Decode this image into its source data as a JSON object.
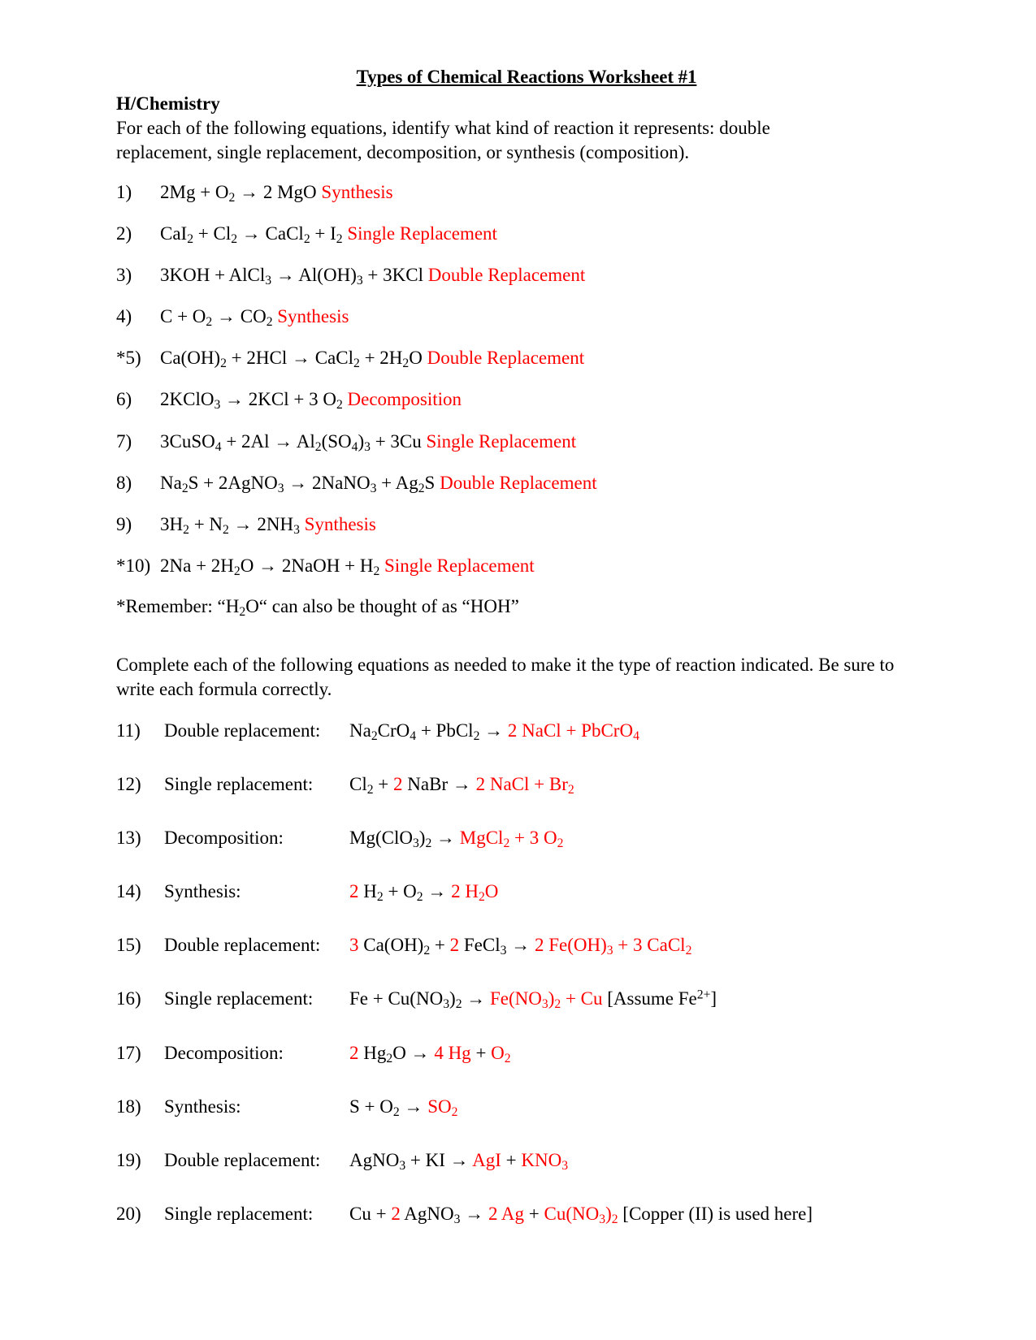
{
  "document": {
    "title": "Types of Chemical Reactions Worksheet #1",
    "course": "H/Chemistry",
    "intro": "For each of the following equations, identify what kind of reaction it represents:  double replacement, single replacement, decomposition, or synthesis (composition).",
    "section2_intro": "Complete each of the following equations as needed to make it the type of reaction indicated.  Be sure to write each formula correctly.",
    "remember_note": "*Remember: “H2O“ can also be thought of as “HOH”"
  },
  "colors": {
    "answer_red": "#ff0000",
    "text_black": "#000000",
    "page_background": "#ffffff"
  },
  "symbols": {
    "arrow": "→"
  },
  "section1": {
    "items": [
      {
        "number": "1)",
        "equation_plain": "2Mg + O2  →  2 MgO",
        "answer_plain": "Synthesis",
        "tokens": [
          {
            "t": "2Mg + O",
            "c": "black"
          },
          {
            "t": "2",
            "c": "black",
            "s": "sub"
          },
          {
            "t": "  →  2 MgO  ",
            "c": "black"
          },
          {
            "t": "Synthesis",
            "c": "red"
          }
        ]
      },
      {
        "number": "2)",
        "equation_plain": "CaI2 + Cl2  →  CaCl2 + I2",
        "answer_plain": "Single Replacement",
        "tokens": [
          {
            "t": "CaI",
            "c": "black"
          },
          {
            "t": "2",
            "c": "black",
            "s": "sub"
          },
          {
            "t": " + Cl",
            "c": "black"
          },
          {
            "t": "2",
            "c": "black",
            "s": "sub"
          },
          {
            "t": "  →  CaCl",
            "c": "black"
          },
          {
            "t": "2",
            "c": "black",
            "s": "sub"
          },
          {
            "t": " + I",
            "c": "black"
          },
          {
            "t": "2",
            "c": "black",
            "s": "sub"
          },
          {
            "t": "   ",
            "c": "black"
          },
          {
            "t": "Single Replacement",
            "c": "red"
          }
        ]
      },
      {
        "number": "3)",
        "equation_plain": "3KOH + AlCl3  →  Al(OH)3 + 3KCl",
        "answer_plain": "Double Replacement",
        "tokens": [
          {
            "t": "3KOH + AlCl",
            "c": "black"
          },
          {
            "t": "3",
            "c": "black",
            "s": "sub"
          },
          {
            "t": "  →  Al(OH)",
            "c": "black"
          },
          {
            "t": "3",
            "c": "black",
            "s": "sub"
          },
          {
            "t": " + 3KCl   ",
            "c": "black"
          },
          {
            "t": "Double Replacement",
            "c": "red"
          }
        ]
      },
      {
        "number": "4)",
        "equation_plain": "C +  O2 → CO2",
        "answer_plain": "Synthesis",
        "tokens": [
          {
            "t": "C +  O",
            "c": "black"
          },
          {
            "t": "2",
            "c": "black",
            "s": "sub"
          },
          {
            "t": " → CO",
            "c": "black"
          },
          {
            "t": "2",
            "c": "black",
            "s": "sub"
          },
          {
            "t": "   ",
            "c": "black"
          },
          {
            "t": "Synthesis",
            "c": "red"
          }
        ]
      },
      {
        "number": "*5)",
        "equation_plain": "Ca(OH)2 + 2HCl  →  CaCl2 + 2H2O",
        "answer_plain": "Double Replacement",
        "tokens": [
          {
            "t": "Ca(OH)",
            "c": "black"
          },
          {
            "t": "2",
            "c": "black",
            "s": "sub"
          },
          {
            "t": " + 2HCl  →  CaCl",
            "c": "black"
          },
          {
            "t": "2",
            "c": "black",
            "s": "sub"
          },
          {
            "t": " + 2H",
            "c": "black"
          },
          {
            "t": "2",
            "c": "black",
            "s": "sub"
          },
          {
            "t": "O   ",
            "c": "black"
          },
          {
            "t": "Double Replacement",
            "c": "red"
          }
        ]
      },
      {
        "number": "6)",
        "equation_plain": "2KClO3  →  2KCl + 3 O2",
        "answer_plain": "Decomposition",
        "tokens": [
          {
            "t": "2KClO",
            "c": "black"
          },
          {
            "t": "3",
            "c": "black",
            "s": "sub"
          },
          {
            "t": "  →  2KCl + 3 O",
            "c": "black"
          },
          {
            "t": "2",
            "c": "black",
            "s": "sub"
          },
          {
            "t": "   ",
            "c": "black"
          },
          {
            "t": "Decomposition",
            "c": "red"
          }
        ]
      },
      {
        "number": "7)",
        "equation_plain": "3CuSO4 + 2Al  →  Al2(SO4)3 + 3Cu",
        "answer_plain": "Single Replacement",
        "tokens": [
          {
            "t": "3CuSO",
            "c": "black"
          },
          {
            "t": "4",
            "c": "black",
            "s": "sub"
          },
          {
            "t": " + 2Al  →  Al",
            "c": "black"
          },
          {
            "t": "2",
            "c": "black",
            "s": "sub"
          },
          {
            "t": "(SO",
            "c": "black"
          },
          {
            "t": "4",
            "c": "black",
            "s": "sub"
          },
          {
            "t": ")",
            "c": "black"
          },
          {
            "t": "3",
            "c": "black",
            "s": "sub"
          },
          {
            "t": " + 3Cu   ",
            "c": "black"
          },
          {
            "t": "Single Replacement",
            "c": "red"
          }
        ]
      },
      {
        "number": "8)",
        "equation_plain": "Na2S + 2AgNO3  →  2NaNO3 + Ag2S",
        "answer_plain": "Double Replacement",
        "tokens": [
          {
            "t": "Na",
            "c": "black"
          },
          {
            "t": "2",
            "c": "black",
            "s": "sub"
          },
          {
            "t": "S + 2AgNO",
            "c": "black"
          },
          {
            "t": "3",
            "c": "black",
            "s": "sub"
          },
          {
            "t": "  →  2NaNO",
            "c": "black"
          },
          {
            "t": "3",
            "c": "black",
            "s": "sub"
          },
          {
            "t": " + Ag",
            "c": "black"
          },
          {
            "t": "2",
            "c": "black",
            "s": "sub"
          },
          {
            "t": "S    ",
            "c": "black"
          },
          {
            "t": "Double Replacement",
            "c": "red"
          }
        ]
      },
      {
        "number": "9)",
        "equation_plain": "3H2 + N2  →  2NH3",
        "answer_plain": "Synthesis",
        "tokens": [
          {
            "t": "3H",
            "c": "black"
          },
          {
            "t": "2",
            "c": "black",
            "s": "sub"
          },
          {
            "t": " + N",
            "c": "black"
          },
          {
            "t": "2",
            "c": "black",
            "s": "sub"
          },
          {
            "t": "  →  2NH",
            "c": "black"
          },
          {
            "t": "3",
            "c": "black",
            "s": "sub"
          },
          {
            "t": "   ",
            "c": "black"
          },
          {
            "t": "Synthesis",
            "c": "red"
          }
        ]
      },
      {
        "number": "*10)",
        "equation_plain": "2Na + 2H2O  →  2NaOH + H2",
        "answer_plain": "Single Replacement",
        "tokens": [
          {
            "t": "2Na + 2H",
            "c": "black"
          },
          {
            "t": "2",
            "c": "black",
            "s": "sub"
          },
          {
            "t": "O  →  2NaOH + H",
            "c": "black"
          },
          {
            "t": "2",
            "c": "black",
            "s": "sub"
          },
          {
            "t": " ",
            "c": "black"
          },
          {
            "t": "Single Replacement",
            "c": "red"
          }
        ]
      }
    ]
  },
  "remember": {
    "tokens": [
      {
        "t": "*Remember: “H",
        "c": "black"
      },
      {
        "t": "2",
        "c": "black",
        "s": "sub"
      },
      {
        "t": "O“ can also be thought of as “HOH”",
        "c": "black"
      }
    ]
  },
  "section2": {
    "items": [
      {
        "number": "11)",
        "label": "Double replacement:",
        "equation_plain": "Na2CrO4 + PbCl2 →  2 NaCl + PbCrO4",
        "tokens": [
          {
            "t": "Na",
            "c": "black"
          },
          {
            "t": "2",
            "c": "black",
            "s": "sub"
          },
          {
            "t": "CrO",
            "c": "black"
          },
          {
            "t": "4",
            "c": "black",
            "s": "sub"
          },
          {
            "t": " + PbCl",
            "c": "black"
          },
          {
            "t": "2",
            "c": "black",
            "s": "sub"
          },
          {
            "t": " →",
            "c": "black"
          },
          {
            "t": "    2 NaCl  +  PbCrO",
            "c": "red"
          },
          {
            "t": "4",
            "c": "red",
            "s": "sub"
          }
        ]
      },
      {
        "number": "12)",
        "label": "Single replacement:",
        "equation_plain": "Cl2 + 2 NaBr → 2 NaCl +  Br2",
        "tokens": [
          {
            "t": "Cl",
            "c": "black"
          },
          {
            "t": "2",
            "c": "black",
            "s": "sub"
          },
          {
            "t": " + ",
            "c": "black"
          },
          {
            "t": "2",
            "c": "red"
          },
          {
            "t": " NaBr ",
            "c": "black"
          },
          {
            "t": "→ ",
            "c": "black"
          },
          {
            "t": "2 NaCl  +   Br",
            "c": "red"
          },
          {
            "t": "2",
            "c": "red",
            "s": "sub"
          }
        ]
      },
      {
        "number": "13)",
        "label": "Decomposition:",
        "equation_plain": "Mg(ClO3)2 → MgCl2  + 3 O2",
        "tokens": [
          {
            "t": "Mg(ClO",
            "c": "black"
          },
          {
            "t": "3",
            "c": "black",
            "s": "sub"
          },
          {
            "t": ")",
            "c": "black"
          },
          {
            "t": "2",
            "c": "black",
            "s": "sub"
          },
          {
            "t": "  →  ",
            "c": "black"
          },
          {
            "t": "MgCl",
            "c": "red"
          },
          {
            "t": "2",
            "c": "red",
            "s": "sub"
          },
          {
            "t": "   +  3 O",
            "c": "red"
          },
          {
            "t": "2",
            "c": "red",
            "s": "sub"
          }
        ]
      },
      {
        "number": "14)",
        "label": "Synthesis:",
        "equation_plain": "2 H2 + O2 → 2 H2O",
        "tokens": [
          {
            "t": "2 ",
            "c": "red"
          },
          {
            "t": "H",
            "c": "black"
          },
          {
            "t": "2",
            "c": "black",
            "s": "sub"
          },
          {
            "t": "  + O",
            "c": "black"
          },
          {
            "t": "2",
            "c": "black",
            "s": "sub"
          },
          {
            "t": "  →  ",
            "c": "black"
          },
          {
            "t": "2 H",
            "c": "red"
          },
          {
            "t": "2",
            "c": "red",
            "s": "sub"
          },
          {
            "t": "O",
            "c": "red"
          }
        ]
      },
      {
        "number": "15)",
        "label": "Double replacement:",
        "equation_plain": "3 Ca(OH)2 + 2 FeCl3 →  2 Fe(OH)3 + 3 CaCl2",
        "tokens": [
          {
            "t": "3 ",
            "c": "red"
          },
          {
            "t": "Ca(OH)",
            "c": "black"
          },
          {
            "t": "2",
            "c": "black",
            "s": "sub"
          },
          {
            "t": " + ",
            "c": "black"
          },
          {
            "t": "2",
            "c": "red"
          },
          {
            "t": " FeCl",
            "c": "black"
          },
          {
            "t": "3",
            "c": "black",
            "s": "sub"
          },
          {
            "t": "  →  ",
            "c": "black"
          },
          {
            "t": "  2 Fe(OH)",
            "c": "red"
          },
          {
            "t": "3",
            "c": "red",
            "s": "sub"
          },
          {
            "t": "  + 3 CaCl",
            "c": "red"
          },
          {
            "t": "2",
            "c": "red",
            "s": "sub"
          }
        ]
      },
      {
        "number": "16)",
        "label": "Single replacement:",
        "equation_plain": "Fe + Cu(NO3)2 →  Fe(NO3)2  + Cu          [Assume Fe2+]",
        "tokens": [
          {
            "t": "Fe + Cu(NO",
            "c": "black"
          },
          {
            "t": "3",
            "c": "black",
            "s": "sub"
          },
          {
            "t": ")",
            "c": "black"
          },
          {
            "t": "2",
            "c": "black",
            "s": "sub"
          },
          {
            "t": "  →  ",
            "c": "black"
          },
          {
            "t": " Fe(NO",
            "c": "red"
          },
          {
            "t": "3",
            "c": "red",
            "s": "sub"
          },
          {
            "t": ")",
            "c": "red"
          },
          {
            "t": "2",
            "c": "red",
            "s": "sub"
          },
          {
            "t": "  +  Cu",
            "c": "red"
          },
          {
            "t": "          [Assume Fe",
            "c": "black"
          },
          {
            "t": "2+",
            "c": "black",
            "s": "sup"
          },
          {
            "t": "]",
            "c": "black"
          }
        ]
      },
      {
        "number": "17)",
        "label": "Decomposition:",
        "equation_plain": "2 Hg2O →  4 Hg + O2",
        "tokens": [
          {
            "t": "2 ",
            "c": "red"
          },
          {
            "t": "Hg",
            "c": "black"
          },
          {
            "t": "2",
            "c": "black",
            "s": "sub"
          },
          {
            "t": "O  → ",
            "c": "black"
          },
          {
            "t": "  4 Hg",
            "c": "red"
          },
          {
            "t": "  +  ",
            "c": "black"
          },
          {
            "t": "O",
            "c": "red"
          },
          {
            "t": "2",
            "c": "red",
            "s": "sub"
          }
        ]
      },
      {
        "number": "18)",
        "label": "Synthesis:",
        "equation_plain": "S + O2 →  SO2",
        "tokens": [
          {
            "t": "S + O",
            "c": "black"
          },
          {
            "t": "2",
            "c": "black",
            "s": "sub"
          },
          {
            "t": "  →  ",
            "c": "black"
          },
          {
            "t": " SO",
            "c": "red"
          },
          {
            "t": "2",
            "c": "red",
            "s": "sub"
          }
        ]
      },
      {
        "number": "19)",
        "label": "Double replacement:",
        "equation_plain": "AgNO3 + KI →  AgI + KNO3",
        "tokens": [
          {
            "t": "AgNO",
            "c": "black"
          },
          {
            "t": "3",
            "c": "black",
            "s": "sub"
          },
          {
            "t": " + KI  →  ",
            "c": "black"
          },
          {
            "t": "AgI",
            "c": "red"
          },
          {
            "t": "  + ",
            "c": "black"
          },
          {
            "t": "KNO",
            "c": "red"
          },
          {
            "t": "3",
            "c": "red",
            "s": "sub"
          }
        ]
      },
      {
        "number": "20)",
        "label": "Single replacement:",
        "equation_plain": "Cu + 2 AgNO3 → 2 Ag + Cu(NO3)2 [Copper (II) is used here]",
        "tokens": [
          {
            "t": "Cu + ",
            "c": "black"
          },
          {
            "t": "2",
            "c": "red"
          },
          {
            "t": " AgNO",
            "c": "black"
          },
          {
            "t": "3",
            "c": "black",
            "s": "sub"
          },
          {
            "t": "  →  ",
            "c": "black"
          },
          {
            "t": "2 Ag",
            "c": "red"
          },
          {
            "t": "  +  ",
            "c": "black"
          },
          {
            "t": "Cu(NO",
            "c": "red"
          },
          {
            "t": "3",
            "c": "red",
            "s": "sub"
          },
          {
            "t": ")",
            "c": "red"
          },
          {
            "t": "2",
            "c": "red",
            "s": "sub"
          },
          {
            "t": " [Copper (II) is used here]",
            "c": "black"
          }
        ]
      }
    ]
  }
}
